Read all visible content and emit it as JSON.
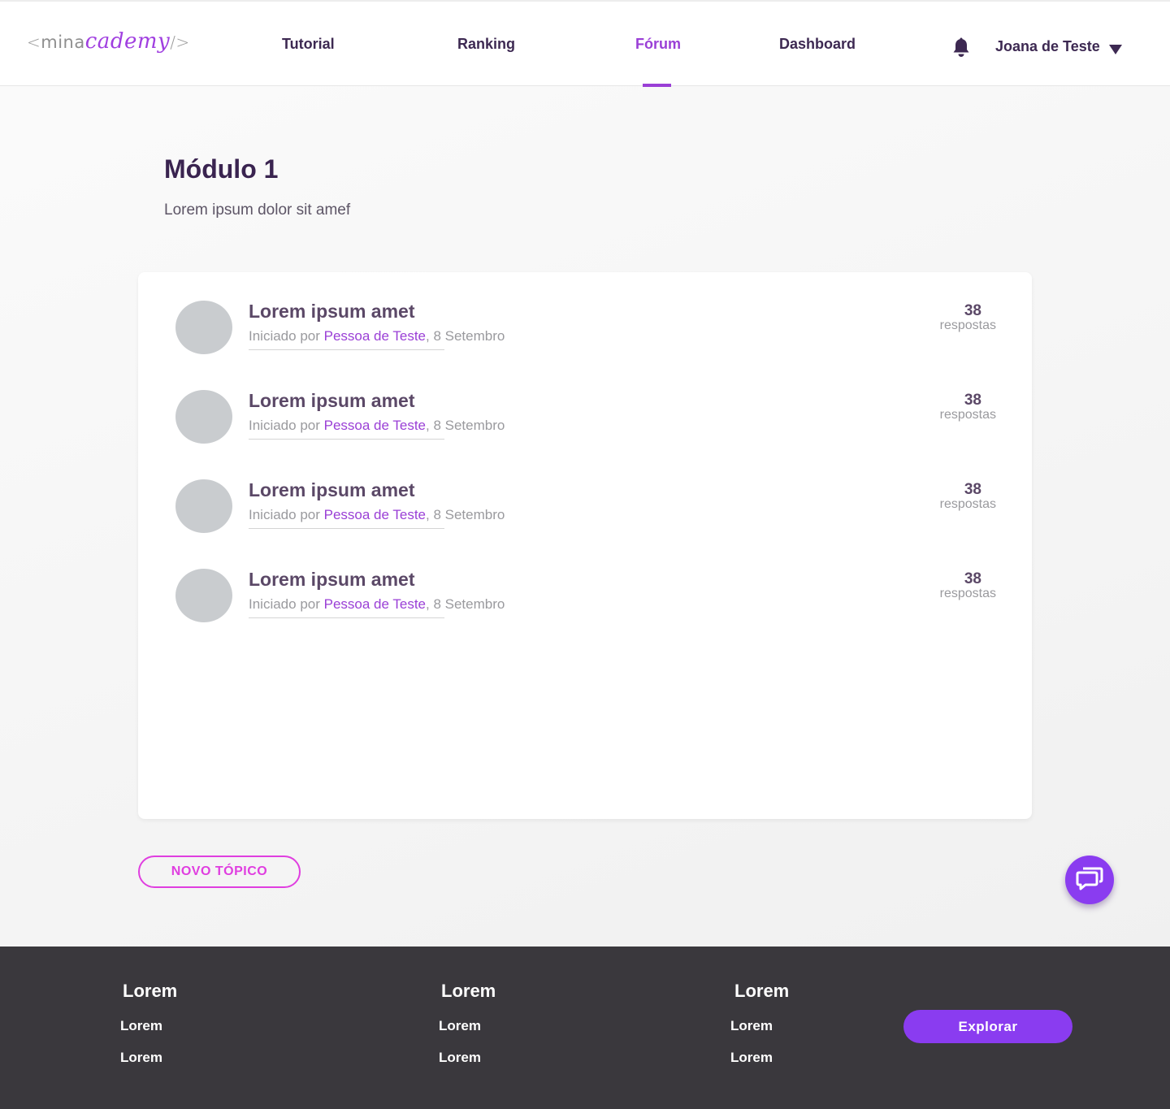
{
  "header": {
    "logo": {
      "open": "<",
      "mina": "mina",
      "cademy": "cademy",
      "close": "/>"
    },
    "nav": [
      {
        "label": "Tutorial"
      },
      {
        "label": "Ranking"
      },
      {
        "label": "Fórum",
        "active": true
      },
      {
        "label": "Dashboard"
      }
    ],
    "user_name": "Joana de Teste",
    "icons": {
      "notifications": "bell-icon",
      "user_menu": "caret-down-icon"
    }
  },
  "page": {
    "title": "Módulo 1",
    "subtitle": "Lorem ipsum dolor sit amef"
  },
  "topics": [
    {
      "title": "Lorem ipsum amet",
      "prefix": "Iniciado por ",
      "author": "Pessoa de Teste",
      "date": ", 8 Setembro",
      "count": "38",
      "count_label": "respostas"
    },
    {
      "title": "Lorem ipsum amet",
      "prefix": "Iniciado por ",
      "author": "Pessoa de Teste",
      "date": ", 8 Setembro",
      "count": "38",
      "count_label": "respostas"
    },
    {
      "title": "Lorem ipsum amet",
      "prefix": "Iniciado por ",
      "author": "Pessoa de Teste",
      "date": ", 8 Setembro",
      "count": "38",
      "count_label": "respostas"
    },
    {
      "title": "Lorem ipsum amet",
      "prefix": "Iniciado por ",
      "author": "Pessoa de Teste",
      "date": ", 8 Setembro",
      "count": "38",
      "count_label": "respostas"
    }
  ],
  "actions": {
    "new_topic": "NOVO TÓPICO",
    "chat_icon": "chat-icon"
  },
  "footer": {
    "columns": [
      {
        "heading": "Lorem",
        "links": [
          "Lorem",
          "Lorem"
        ]
      },
      {
        "heading": "Lorem",
        "links": [
          "Lorem",
          "Lorem"
        ]
      },
      {
        "heading": "Lorem",
        "links": [
          "Lorem",
          "Lorem"
        ]
      }
    ],
    "explore": "Explorar"
  },
  "colors": {
    "accent": "#9a3fd6",
    "button_outline": "#e03ee0",
    "fab": "#8a3cf0",
    "footer_bg": "#3a383d",
    "text_dark": "#3d2952"
  }
}
